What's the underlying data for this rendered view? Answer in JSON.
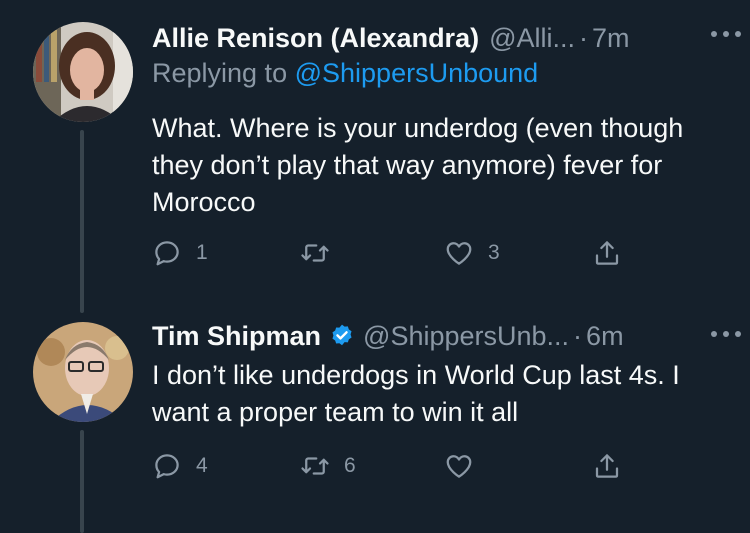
{
  "tweets": [
    {
      "name": "Allie Renison (Alexandra)",
      "handle": "@Alli...",
      "time": "7m",
      "replying_label": "Replying to",
      "replying_handle": "@ShippersUnbound",
      "text": "What. Where is your underdog (even though they don’t play that way anymore) fever for Morocco",
      "counts": {
        "reply": "1",
        "retweet": "",
        "like": "3"
      }
    },
    {
      "name": "Tim Shipman",
      "verified": true,
      "handle": "@ShippersUnb...",
      "time": "6m",
      "text": "I don’t like underdogs in World Cup last 4s. I want a proper team to win it all",
      "counts": {
        "reply": "4",
        "retweet": "6",
        "like": ""
      }
    }
  ],
  "colors": {
    "background": "#15202b",
    "text": "#f7f9f9",
    "muted": "#8b98a5",
    "accent": "#1d9bf0",
    "thread_line": "#38444d"
  },
  "icons": [
    "more-icon",
    "reply-icon",
    "retweet-icon",
    "like-icon",
    "share-icon",
    "verified-badge-icon"
  ]
}
